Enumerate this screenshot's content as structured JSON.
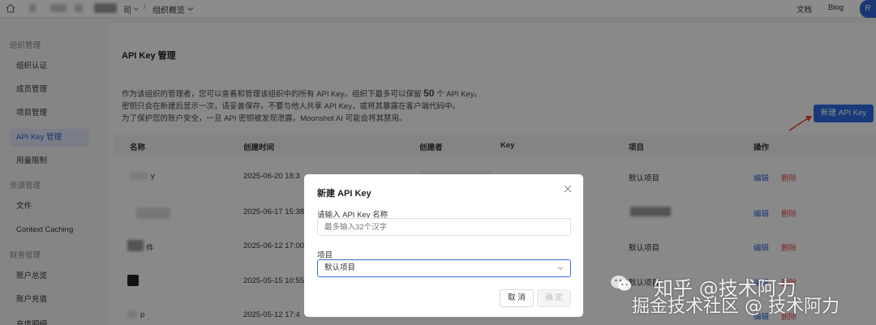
{
  "topbar": {
    "breadcrumb_org": "司",
    "breadcrumb_sep": "/",
    "breadcrumb_page": "组织概览",
    "docs_label": "文档",
    "blog_label": "Blog",
    "avatar_letter": "R"
  },
  "sidebar": {
    "sections": [
      {
        "title": "组织管理",
        "items": [
          "组织认证",
          "成员管理",
          "项目管理",
          "API Key 管理",
          "用量限制"
        ]
      },
      {
        "title": "资源管理",
        "items": [
          "文件",
          "Context Caching"
        ]
      },
      {
        "title": "财务管理",
        "items": [
          "账户总览",
          "账户充值",
          "充值明细"
        ]
      }
    ],
    "active_item": "API Key 管理"
  },
  "main": {
    "title": "API Key 管理",
    "info_line1_before": "作为该组织的管理者，您可以查看和管理该组织中的所有 API Key。组织下最多可以保留",
    "info_line1_count": "50",
    "info_line1_after": "个 API Key。",
    "info_line2": "密钥只会在新建后显示一次，请妥善保存。不要与他人共享 API Key，或将其暴露在客户端代码中。",
    "info_line3": "为了保护您的账户安全，一旦 API 密钥被发现泄露，Moonshot AI 可能会将其禁用。",
    "new_key_button": "新建 API Key",
    "table": {
      "headers": [
        "名称",
        "创建时间",
        "创建者",
        "Key",
        "项目",
        "操作"
      ],
      "rows": [
        {
          "name": "y",
          "created": "2025-06-20 18:3",
          "project": "默认项目",
          "edit": "编辑",
          "delete": "删除"
        },
        {
          "name": "",
          "created": "2025-06-17 15:38",
          "project": "",
          "edit": "编辑",
          "delete": "删除"
        },
        {
          "name": "件",
          "created": "2025-06-12 17:00",
          "project": "默认项目",
          "edit": "编辑",
          "delete": "删除"
        },
        {
          "name": "",
          "created": "2025-05-15 10:55",
          "project": "默认项目",
          "edit": "编辑",
          "delete": "删除"
        },
        {
          "name": "p",
          "created": "2025-05-12 17:4",
          "project": "",
          "edit": "编辑",
          "delete": "删除"
        }
      ]
    }
  },
  "modal": {
    "title": "新建 API Key",
    "name_label": "请输入 API Key 名称",
    "name_placeholder": "最多输入32个汉字",
    "project_label": "项目",
    "project_value": "默认项目",
    "cancel_button": "取 消",
    "confirm_button": "确 定"
  },
  "watermark": {
    "line1": "知乎 @技术阿力",
    "line2": "掘金技术社区 @ 技术阿力"
  },
  "colors": {
    "accent": "#2d6ae0",
    "danger": "#e04a4a",
    "arrow": "#e8412c"
  }
}
